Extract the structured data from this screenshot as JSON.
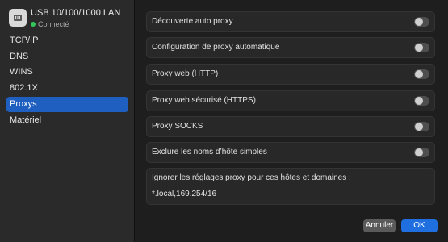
{
  "sidebar": {
    "device_title": "USB 10/100/1000 LAN",
    "device_status": "Connecté",
    "items": [
      {
        "label": "TCP/IP"
      },
      {
        "label": "DNS"
      },
      {
        "label": "WINS"
      },
      {
        "label": "802.1X"
      },
      {
        "label": "Proxys",
        "selected": true
      },
      {
        "label": "Matériel"
      }
    ]
  },
  "proxies": {
    "rows": [
      {
        "label": "Découverte auto proxy",
        "enabled": false
      },
      {
        "label": "Configuration de proxy automatique",
        "enabled": false
      },
      {
        "label": "Proxy web (HTTP)",
        "enabled": false
      },
      {
        "label": "Proxy web sécurisé (HTTPS)",
        "enabled": false
      },
      {
        "label": "Proxy SOCKS",
        "enabled": false
      },
      {
        "label": "Exclure les noms d’hôte simples",
        "enabled": false
      }
    ],
    "bypass_label": "Ignorer les réglages proxy pour ces hôtes et domaines :",
    "bypass_value": "*.local,169.254/16"
  },
  "buttons": {
    "cancel": "Annuler",
    "ok": "OK"
  },
  "colors": {
    "accent": "#1f6fe0",
    "selection": "#1f5fbf",
    "status_connected": "#33c759"
  },
  "icons": {
    "device": "ethernet-icon"
  }
}
